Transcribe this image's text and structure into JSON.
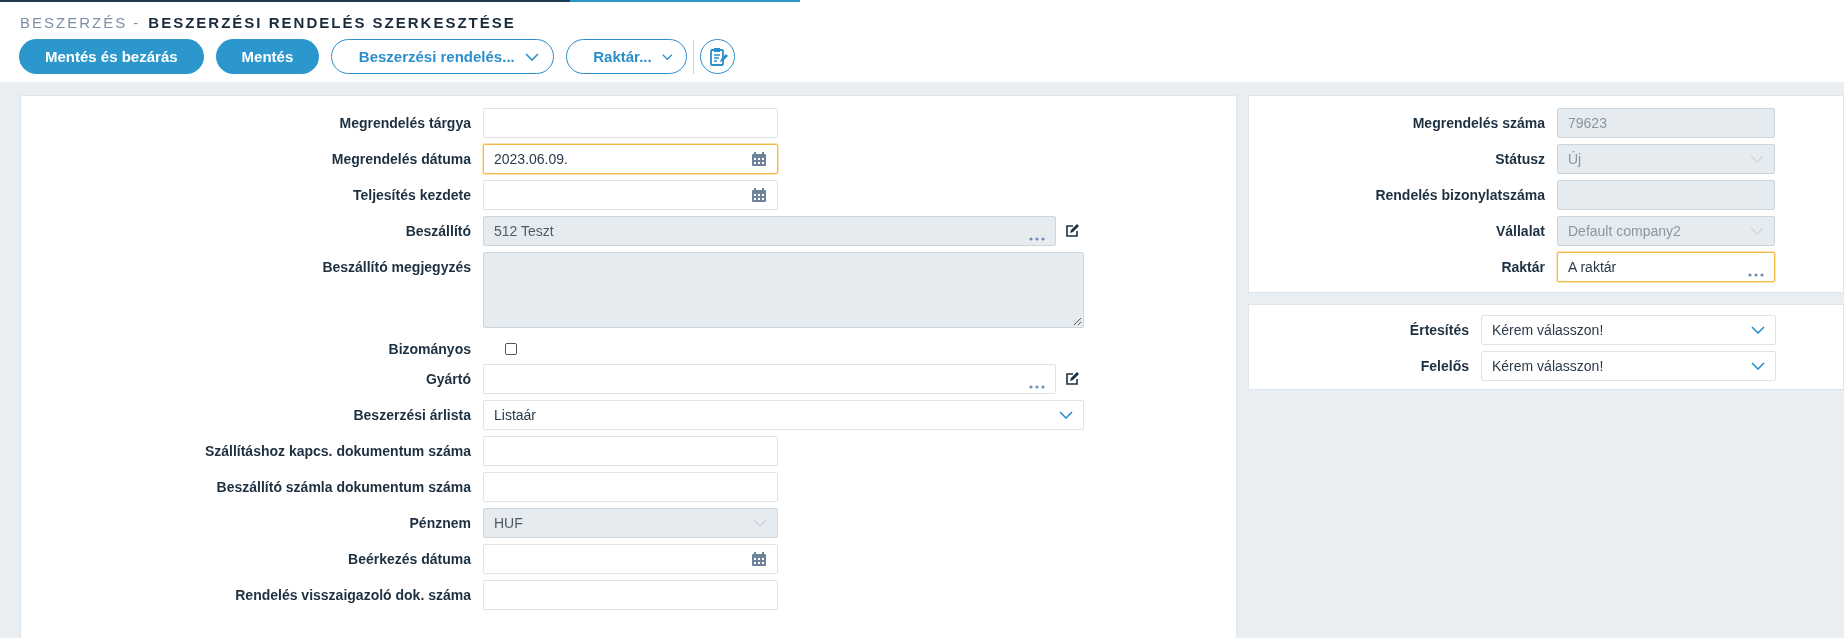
{
  "breadcrumb": {
    "section": "BESZERZÉS -",
    "title": "BESZERZÉSI RENDELÉS SZERKESZTÉSE"
  },
  "toolbar": [
    {
      "kind": "primary",
      "label": "Mentés és bezárás"
    },
    {
      "kind": "primary",
      "label": "Mentés"
    },
    {
      "kind": "dropdown",
      "label": "Beszerzési rendelés..."
    },
    {
      "kind": "dropdown",
      "label": "Raktár..."
    },
    {
      "kind": "icon"
    }
  ],
  "main_form": {
    "fields": [
      {
        "label": "Megrendelés tárgya",
        "kind": "text",
        "disabled": false,
        "focused": false
      },
      {
        "label": "Megrendelés dátuma",
        "kind": "date",
        "value": "2023.06.09.",
        "disabled": false,
        "focused": true
      },
      {
        "label": "Teljesítés kezdete",
        "kind": "date",
        "disabled": false,
        "focused": false
      },
      {
        "label": "Beszállító",
        "kind": "lookup",
        "value": "512 Teszt",
        "disabled": true,
        "focused": false,
        "edit": true
      },
      {
        "label": "Beszállító megjegyzés",
        "kind": "textarea",
        "disabled": true,
        "focused": false
      },
      {
        "label": "Bizományos",
        "kind": "checkbox",
        "checked": false
      },
      {
        "label": "Gyártó",
        "kind": "lookup",
        "disabled": false,
        "focused": false,
        "edit": true
      },
      {
        "label": "Beszerzési árlista",
        "kind": "select",
        "value": "Listaár",
        "disabled": false,
        "focused": false
      },
      {
        "label": "Szállításhoz kapcs. dokumentum száma",
        "kind": "text",
        "disabled": false,
        "focused": false
      },
      {
        "label": "Beszállító számla dokumentum száma",
        "kind": "text",
        "disabled": false,
        "focused": false
      },
      {
        "label": "Pénznem",
        "kind": "select",
        "value": "HUF",
        "disabled": true,
        "focused": false
      },
      {
        "label": "Beérkezés dátuma",
        "kind": "date",
        "disabled": false,
        "focused": false
      },
      {
        "label": "Rendelés visszaigazoló dok. száma",
        "kind": "text",
        "disabled": false,
        "focused": false
      }
    ]
  },
  "order_panel": {
    "fields": [
      {
        "label": "Megrendelés száma",
        "kind": "text",
        "value": "79623",
        "disabled": true,
        "focused": false
      },
      {
        "label": "Státusz",
        "kind": "select",
        "value": "Új",
        "disabled": true,
        "focused": false
      },
      {
        "label": "Rendelés bizonylatszáma",
        "kind": "text",
        "disabled": true,
        "focused": false
      },
      {
        "label": "Vállalat",
        "kind": "select",
        "value": "Default company2",
        "disabled": true,
        "focused": false
      },
      {
        "label": "Raktár",
        "kind": "lookup",
        "value": "A raktár",
        "disabled": false,
        "focused": true,
        "edit": false
      }
    ]
  },
  "people_panel": {
    "fields": [
      {
        "label": "Értesítés",
        "kind": "select",
        "value": "Kérem válasszon!",
        "disabled": false,
        "focused": false
      },
      {
        "label": "Felelős",
        "kind": "select",
        "value": "Kérem válasszon!",
        "disabled": false,
        "focused": false
      }
    ]
  }
}
